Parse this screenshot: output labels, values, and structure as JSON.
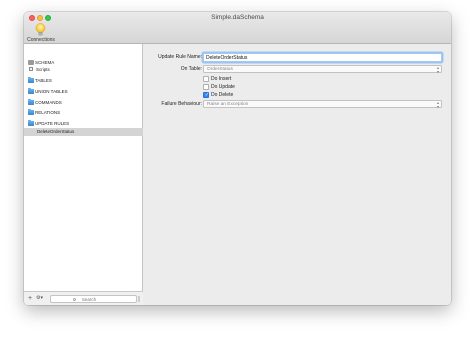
{
  "window": {
    "title": "Simple.daSchema"
  },
  "toolbar": {
    "connections_label": "Connections",
    "connections_icon": "lightbulb-icon"
  },
  "sidebar": {
    "items": [
      {
        "label": "SCHEMA",
        "icon": "database-icon"
      },
      {
        "label": "Scripts",
        "icon": "scripts-icon"
      },
      {
        "label": "TABLES",
        "icon": "folder-icon"
      },
      {
        "label": "UNION TABLES",
        "icon": "folder-icon"
      },
      {
        "label": "COMMANDS",
        "icon": "folder-icon"
      },
      {
        "label": "RELATIONS",
        "icon": "folder-icon"
      },
      {
        "label": "UPDATE RULES",
        "icon": "folder-icon"
      },
      {
        "label": "DeleteOrderStatus",
        "icon": "",
        "selected": true
      }
    ],
    "footer": {
      "add": "+",
      "action": "⚙▾",
      "search_placeholder": "Search"
    }
  },
  "form": {
    "rule_name_label": "Update Rule Name:",
    "rule_name_value": "DeleteOrderStatus",
    "on_table_label": "On Table:",
    "on_table_value": "OrderStatus",
    "do_insert_label": "Do Insert",
    "do_insert_checked": false,
    "do_update_label": "Do Update",
    "do_update_checked": false,
    "do_delete_label": "Do Delete",
    "do_delete_checked": true,
    "failure_label": "Failure Behaviour:",
    "failure_value": "Raise an Exception"
  },
  "colors": {
    "accent": "#2f83f2",
    "selection": "#d4d4d4",
    "folder": "#3b86d4"
  }
}
